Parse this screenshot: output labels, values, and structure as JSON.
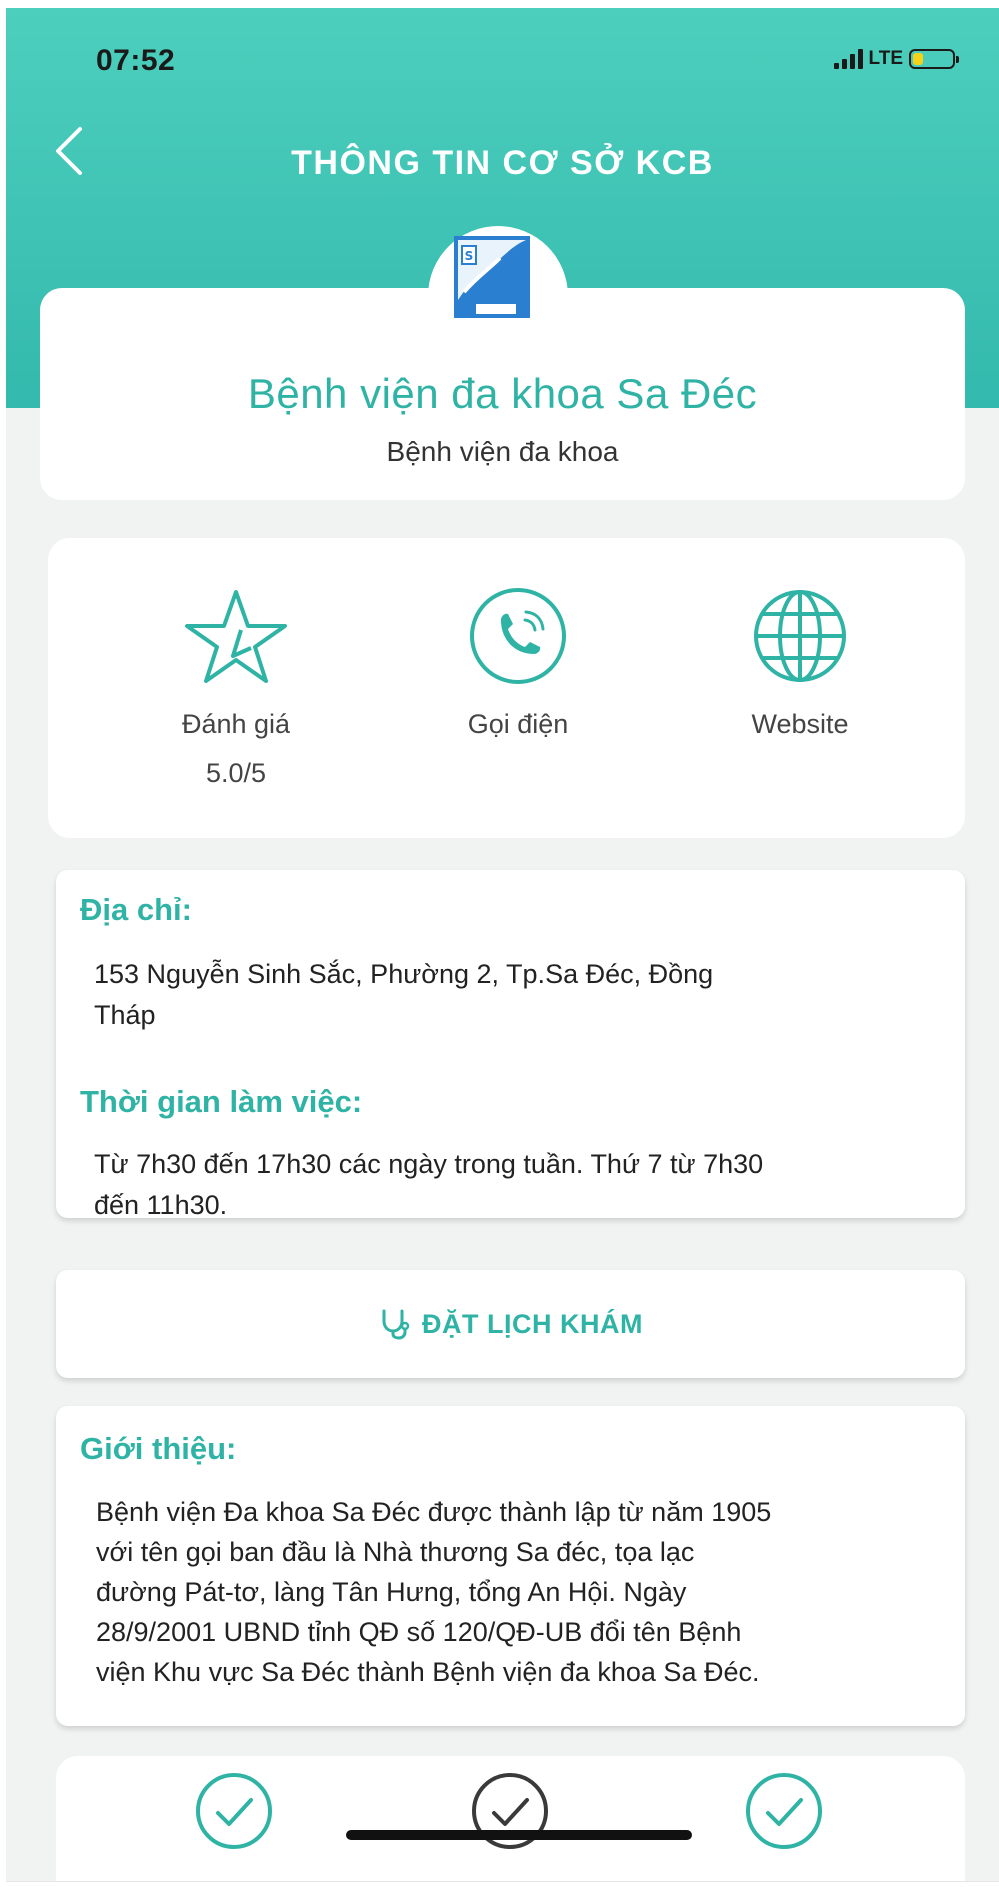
{
  "status_bar": {
    "time": "07:52",
    "network": "LTE",
    "battery_color": "#f6d21b"
  },
  "header": {
    "title": "THÔNG TIN CƠ SỞ KCB",
    "back_icon": "chevron-left-icon"
  },
  "facility": {
    "name": "Bệnh viện đa khoa Sa Đéc",
    "type": "Bệnh viện đa khoa",
    "logo_icon": "hospital-logo"
  },
  "actions": {
    "rating": {
      "label": "Đánh giá",
      "value": "5.0/5",
      "icon": "star-icon"
    },
    "call": {
      "label": "Gọi điện",
      "icon": "phone-icon"
    },
    "website": {
      "label": "Website",
      "icon": "globe-icon"
    }
  },
  "details": {
    "address_label": "Địa chỉ:",
    "address_line1": "153 Nguyễn Sinh Sắc, Phường 2, Tp.Sa Đéc, Đồng",
    "address_line2": "Tháp",
    "hours_label": "Thời gian làm việc:",
    "hours_line1": "Từ 7h30 đến 17h30 các ngày trong tuần. Thứ 7 từ 7h30",
    "hours_line2": "đến 11h30."
  },
  "booking": {
    "label": "ĐẶT LỊCH KHÁM",
    "icon": "stethoscope-icon"
  },
  "intro": {
    "label": "Giới thiệu:",
    "lines": [
      "Bệnh viện Đa khoa Sa Đéc được thành lập từ năm 1905",
      "với tên gọi ban đầu là Nhà thương Sa đéc, tọa lạc",
      "đường Pát-tơ, làng Tân Hưng, tổng An Hội. Ngày",
      "28/9/2001 UBND tỉnh QĐ số 120/QĐ-UB đổi tên Bệnh",
      "viện Khu vực Sa Đéc thành Bệnh viện đa khoa Sa Đéc."
    ]
  },
  "colors": {
    "accent": "#2fb3a5",
    "header_top": "#4dcfbd",
    "header_bottom": "#33b9ad",
    "background": "#f1f3f2"
  }
}
